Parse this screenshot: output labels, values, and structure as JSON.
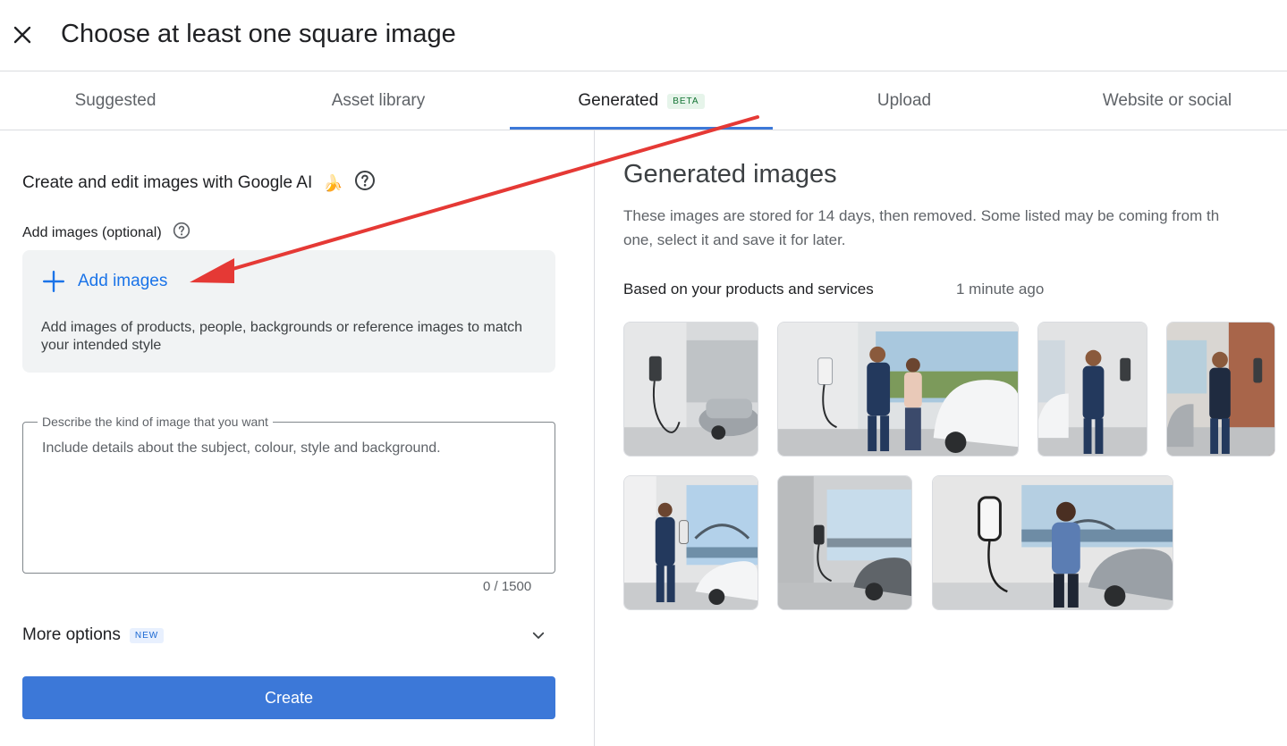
{
  "header": {
    "title": "Choose at least one square image",
    "close_icon": "close-icon"
  },
  "tabs": [
    {
      "label": "Suggested",
      "active": false
    },
    {
      "label": "Asset library",
      "active": false
    },
    {
      "label": "Generated",
      "active": true,
      "badge": "BETA"
    },
    {
      "label": "Upload",
      "active": false
    },
    {
      "label": "Website or social",
      "active": false
    }
  ],
  "left": {
    "intro": "Create and edit images with Google AI",
    "intro_emoji": "🍌",
    "add_images_label": "Add images (optional)",
    "add_images_button": "Add images",
    "add_images_desc": "Add images of products, people, backgrounds or reference images to match your intended style",
    "describe_legend": "Describe the kind of image that you want",
    "describe_placeholder": "Include details about the subject, colour, style and background.",
    "describe_value": "",
    "char_count": "0 / 1500",
    "more_options": "More options",
    "more_options_badge": "NEW",
    "create_button": "Create"
  },
  "right": {
    "title": "Generated images",
    "desc_line1": "These images are stored for 14 days, then removed. Some listed may be coming from th",
    "desc_line2": "one, select it and save it for later.",
    "based_on": "Based on your products and services",
    "time_ago": "1 minute ago"
  },
  "colors": {
    "accent": "#3c78d8",
    "link": "#1a73e8",
    "annotation_arrow": "#e53935"
  }
}
